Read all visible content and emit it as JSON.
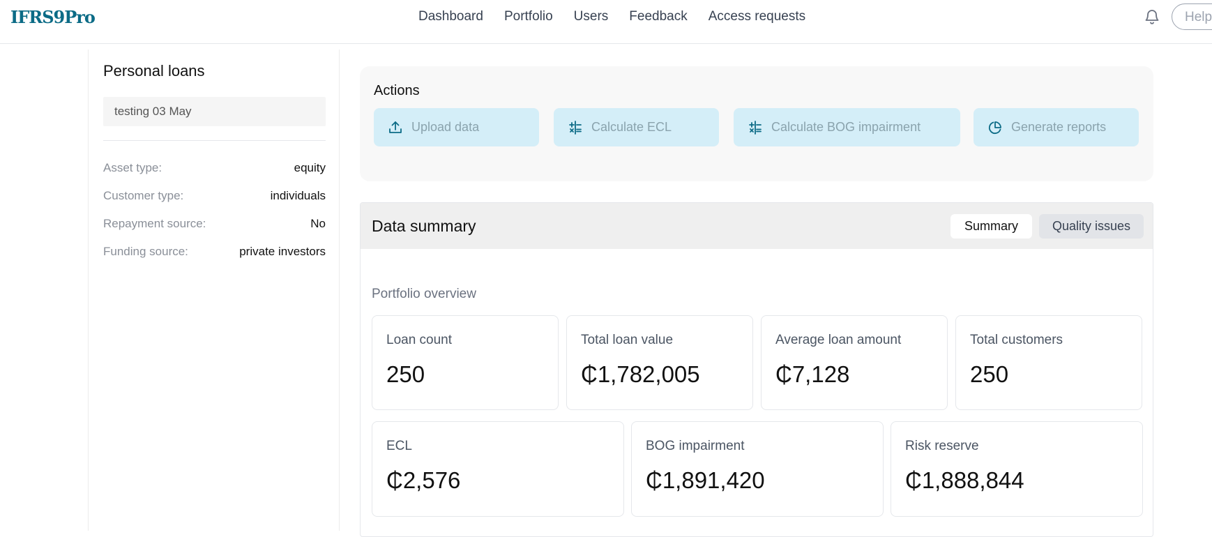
{
  "header": {
    "logo": "IFRS9Pro",
    "nav": [
      "Dashboard",
      "Portfolio",
      "Users",
      "Feedback",
      "Access requests"
    ],
    "help_label": "Help",
    "bell_icon": "bell-icon"
  },
  "sidebar": {
    "title": "Personal loans",
    "input_value": "testing 03 May",
    "details": [
      {
        "label": "Asset type:",
        "value": "equity"
      },
      {
        "label": "Customer type:",
        "value": "individuals"
      },
      {
        "label": "Repayment source:",
        "value": "No"
      },
      {
        "label": "Funding source:",
        "value": "private investors"
      }
    ]
  },
  "actions": {
    "title": "Actions",
    "buttons": [
      {
        "label": "Upload data",
        "icon": "upload-icon"
      },
      {
        "label": "Calculate ECL",
        "icon": "calculator-icon"
      },
      {
        "label": "Calculate BOG impairment",
        "icon": "calculator-icon"
      },
      {
        "label": "Generate reports",
        "icon": "pie-chart-icon"
      }
    ]
  },
  "summary": {
    "title": "Data summary",
    "tabs": [
      "Summary",
      "Quality issues"
    ],
    "active_tab": "Summary",
    "section": "Portfolio overview",
    "stats_row1": [
      {
        "label": "Loan count",
        "value": "250"
      },
      {
        "label": "Total loan value",
        "value": "₵1,782,005"
      },
      {
        "label": "Average loan amount",
        "value": "₵7,128"
      },
      {
        "label": "Total customers",
        "value": "250"
      }
    ],
    "stats_row2": [
      {
        "label": "ECL",
        "value": "₵2,576"
      },
      {
        "label": "BOG impairment",
        "value": "₵1,891,420"
      },
      {
        "label": "Risk reserve",
        "value": "₵1,888,844"
      }
    ]
  },
  "colors": {
    "brand": "#0b6b86",
    "action_button_bg": "#d4eef8",
    "action_icon": "#0b6b86"
  }
}
